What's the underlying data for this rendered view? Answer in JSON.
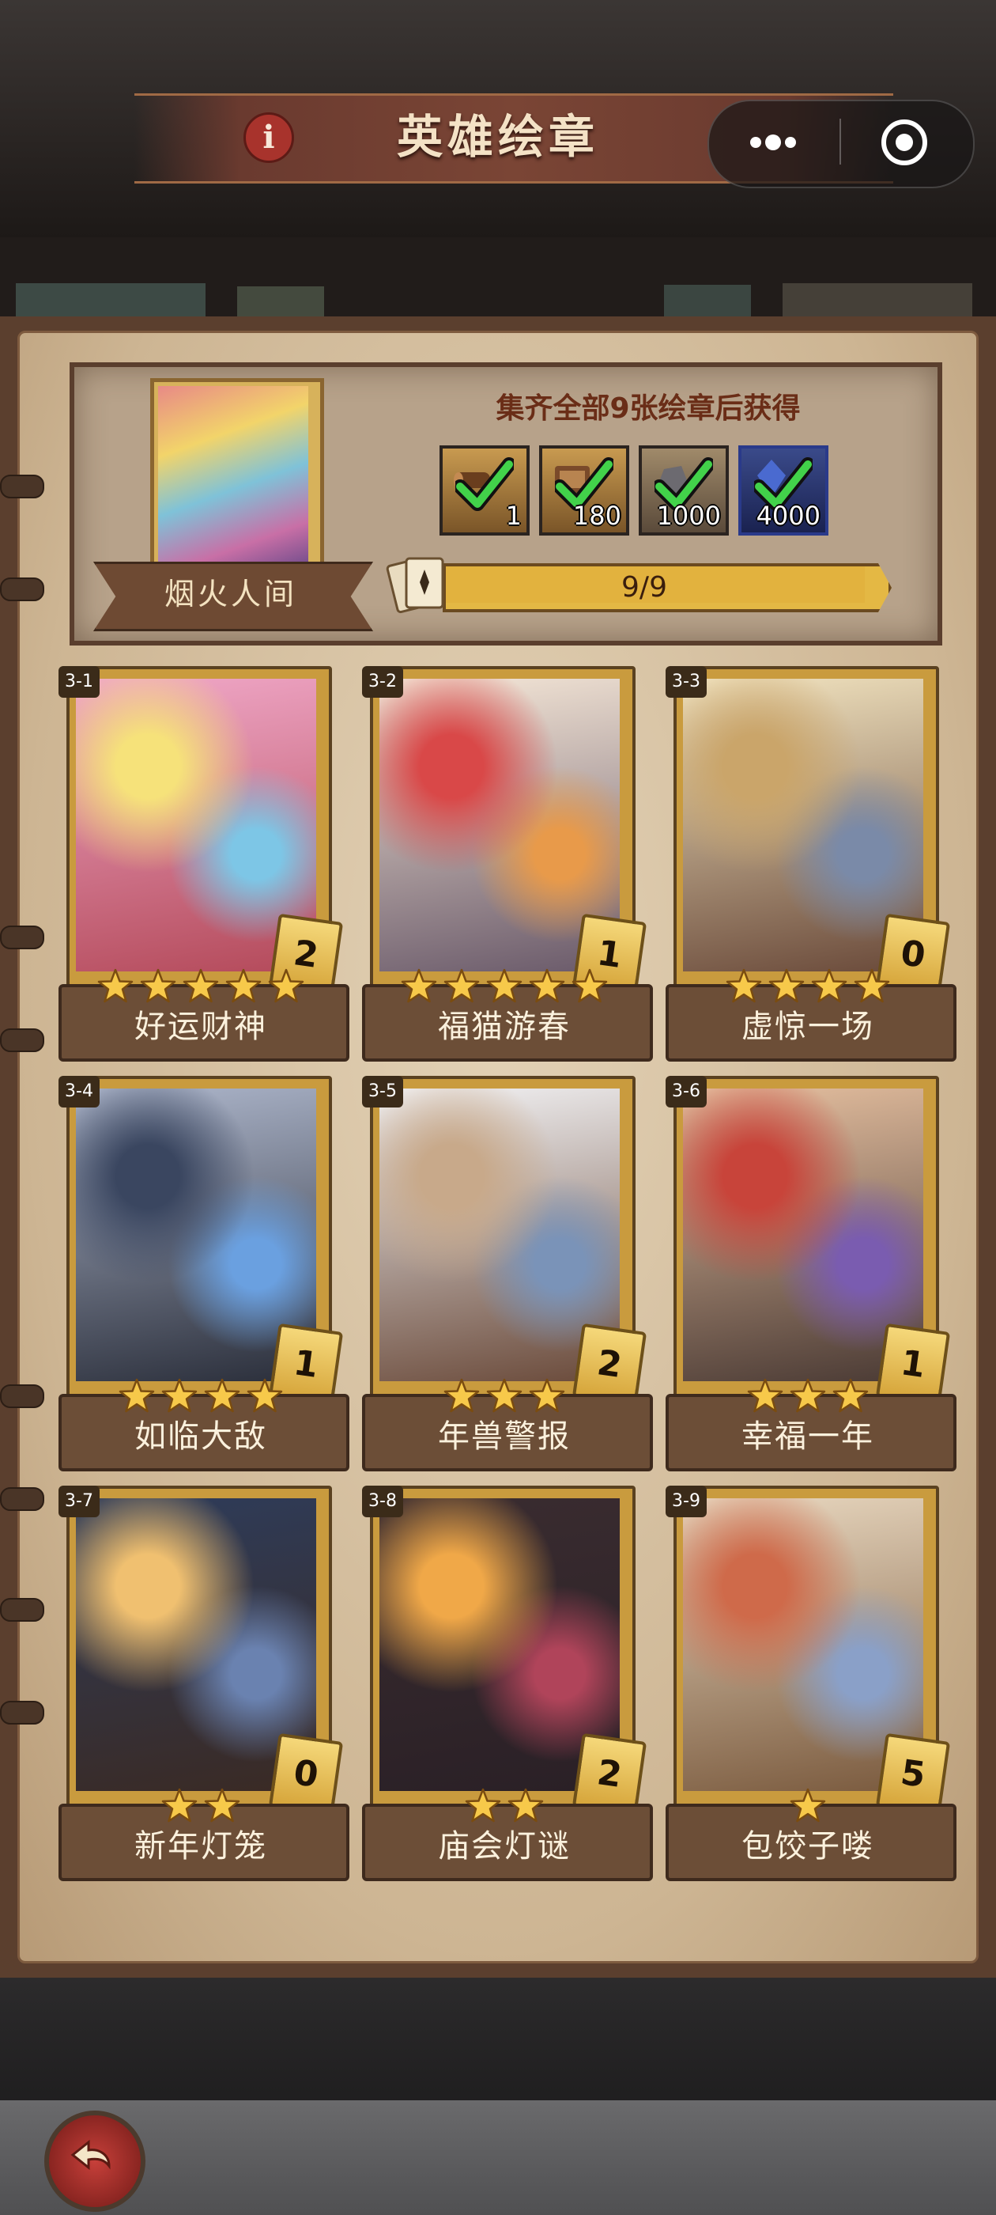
{
  "header": {
    "title": "英雄绘章",
    "info_icon": "info-icon",
    "more_icon": "more-dots-icon",
    "close_icon": "target-close-icon"
  },
  "banner": {
    "collection_title": "烟火人间",
    "reward_caption": "集齐全部9张绘章后获得",
    "rewards": [
      {
        "item_icon": "wood-log-icon",
        "qty": "1",
        "claimed": true
      },
      {
        "item_icon": "treasure-map-icon",
        "qty": "180",
        "claimed": true
      },
      {
        "item_icon": "stone-ore-icon",
        "qty": "1000",
        "claimed": true
      },
      {
        "item_icon": "blue-crystal-icon",
        "qty": "4000",
        "claimed": true
      }
    ],
    "progress_text": "9/9",
    "progress_value": 1.0
  },
  "cards": [
    {
      "number": "3-1",
      "name": "好运财神",
      "count": "2",
      "stars": 5,
      "palette": [
        "#f0a8c8",
        "#f6e27a",
        "#7dc6e6",
        "#b44a5a"
      ]
    },
    {
      "number": "3-2",
      "name": "福猫游春",
      "count": "1",
      "stars": 5,
      "palette": [
        "#f6e8d8",
        "#d94848",
        "#e89a4a",
        "#6a5a6a"
      ]
    },
    {
      "number": "3-3",
      "name": "虚惊一场",
      "count": "0",
      "stars": 4,
      "palette": [
        "#f2e4c0",
        "#caa56a",
        "#7a8aa8",
        "#6a4a3a"
      ]
    },
    {
      "number": "3-4",
      "name": "如临大敌",
      "count": "1",
      "stars": 4,
      "palette": [
        "#aeb7cc",
        "#3a4660",
        "#6aa0e0",
        "#2a2e3a"
      ]
    },
    {
      "number": "3-5",
      "name": "年兽警报",
      "count": "2",
      "stars": 3,
      "palette": [
        "#f3f3f5",
        "#c8a98a",
        "#7a93b8",
        "#6a4a3a"
      ]
    },
    {
      "number": "3-6",
      "name": "幸福一年",
      "count": "1",
      "stars": 3,
      "palette": [
        "#e6c0a0",
        "#c8443a",
        "#7a5cb0",
        "#4a3a34"
      ]
    },
    {
      "number": "3-7",
      "name": "新年灯笼",
      "count": "0",
      "stars": 2,
      "palette": [
        "#2e3c5a",
        "#f0c070",
        "#6a82b0",
        "#3a2a24"
      ]
    },
    {
      "number": "3-8",
      "name": "庙会灯谜",
      "count": "2",
      "stars": 2,
      "palette": [
        "#3a2c30",
        "#f0a848",
        "#b0445a",
        "#2a2026"
      ]
    },
    {
      "number": "3-9",
      "name": "包饺子喽",
      "count": "5",
      "stars": 1,
      "palette": [
        "#e9d8c0",
        "#cf6a4a",
        "#8aa0c8",
        "#7a5a3e"
      ]
    }
  ],
  "footer": {
    "back_icon": "back-arrow-icon"
  }
}
